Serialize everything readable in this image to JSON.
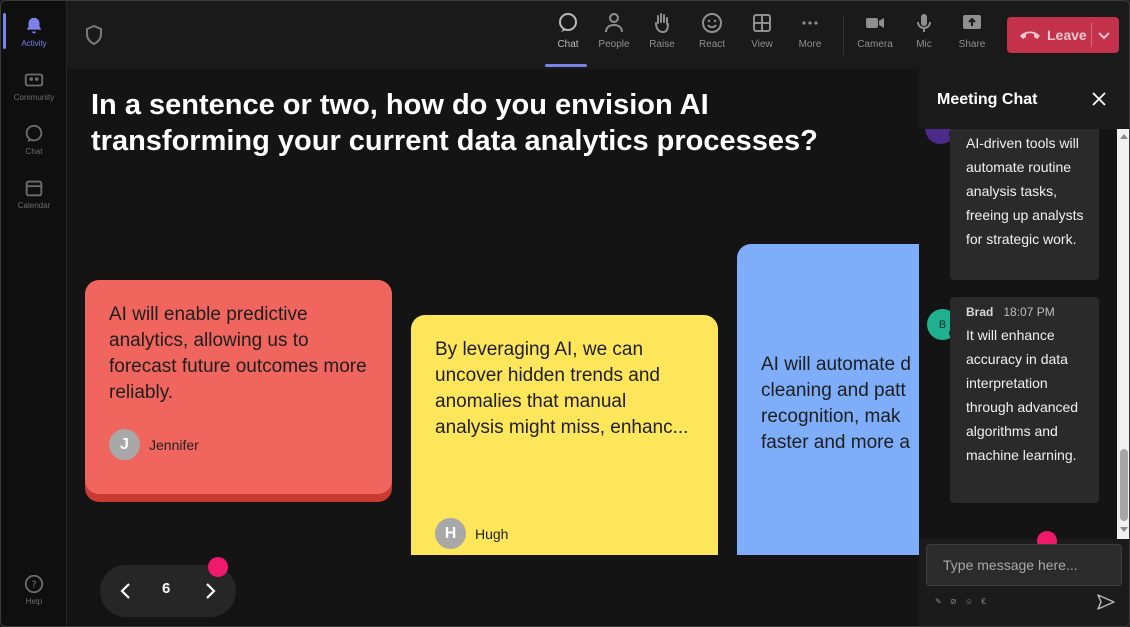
{
  "rail": {
    "items": [
      {
        "label": "Activity",
        "icon": "bell-icon"
      },
      {
        "label": "Community",
        "icon": "community-icon"
      },
      {
        "label": "Chat",
        "icon": "chat-icon"
      },
      {
        "label": "Calendar",
        "icon": "calendar-icon"
      }
    ],
    "help_label": "Help"
  },
  "toolbar": {
    "chat": "Chat",
    "people": "People",
    "raise": "Raise",
    "react": "React",
    "view": "View",
    "more": "More",
    "camera": "Camera",
    "mic": "Mic",
    "share": "Share",
    "leave": "Leave"
  },
  "stage": {
    "question": "In a sentence or two, how do you envision AI transforming your current data analytics processes?",
    "cards": [
      {
        "text": "AI will enable predictive analytics, allowing us to forecast future outcomes more reliably.",
        "author": "Jennifer",
        "initial": "J",
        "color": "#f0655e"
      },
      {
        "text": "By leveraging AI, we can uncover hidden trends and anomalies that manual analysis might miss, enhanc...",
        "author": "Hugh",
        "initial": "H",
        "color": "#fde65a"
      },
      {
        "text": "AI will automate d\ncleaning and patt\nrecognition, mak\nfaster and more a",
        "color": "#7eaef9"
      }
    ],
    "page": "6"
  },
  "chat": {
    "title": "Meeting Chat",
    "messages": [
      {
        "text": "AI-driven tools will automate routine analysis tasks, freeing up analysts for strategic work."
      },
      {
        "sender": "Brad",
        "time": "18:07 PM",
        "initial": "B",
        "text": "It will enhance accuracy in data interpretation through advanced algorithms and machine learning."
      }
    ],
    "placeholder": "Type message here...",
    "tools": "✎ ⊘ ☺ €"
  },
  "colors": {
    "accent": "#7b83eb",
    "leave": "#c4314b",
    "pink_marker": "#f0196b"
  }
}
